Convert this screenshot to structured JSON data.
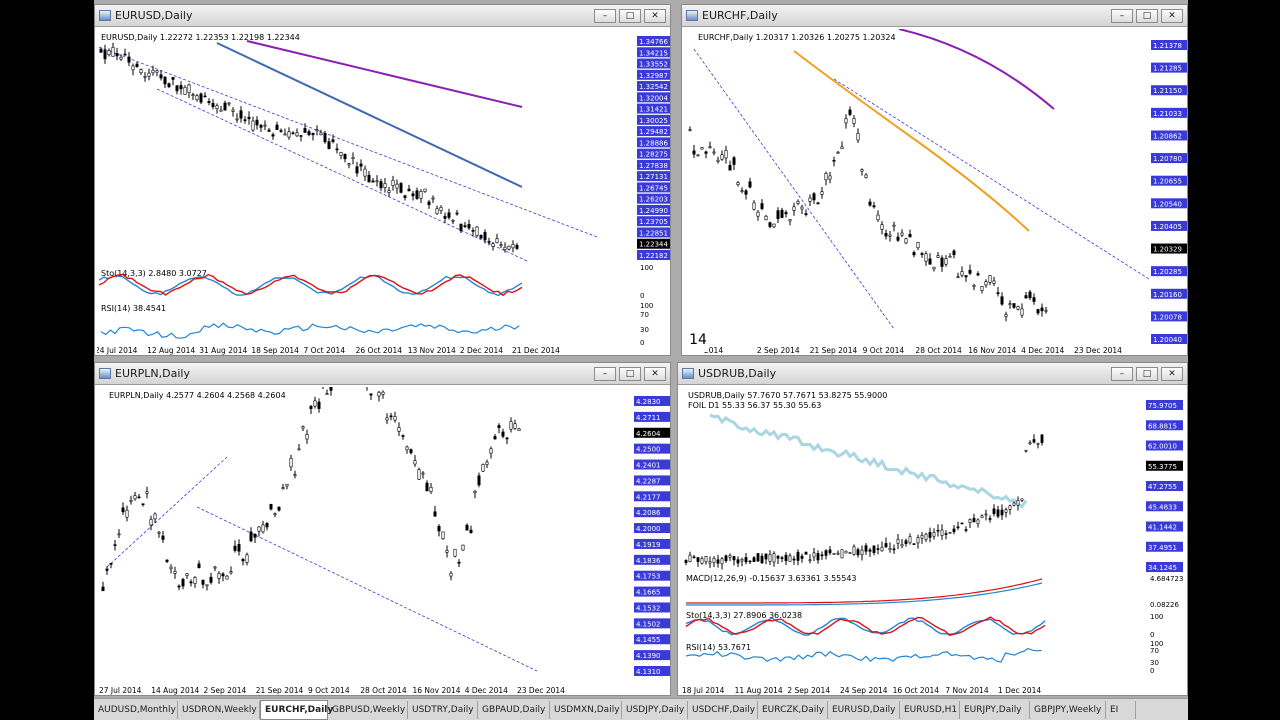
{
  "tabs": [
    {
      "label": "AUDUSD,Monthly",
      "w": 84
    },
    {
      "label": "USDRON,Weekly",
      "w": 82
    },
    {
      "label": "EURCHF,Daily",
      "w": 68,
      "active": true
    },
    {
      "label": "GBPUSD,Weekly",
      "w": 80
    },
    {
      "label": "USDTRY,Daily",
      "w": 70
    },
    {
      "label": "GBPAUD,Daily",
      "w": 72
    },
    {
      "label": "USDMXN,Daily",
      "w": 72
    },
    {
      "label": "USDJPY,Daily",
      "w": 66
    },
    {
      "label": "USDCHF,Daily",
      "w": 70
    },
    {
      "label": "EURCZK,Daily",
      "w": 70
    },
    {
      "label": "EURUSD,Daily",
      "w": 72
    },
    {
      "label": "EURUSD,H1",
      "w": 60
    },
    {
      "label": "EURJPY,Daily",
      "w": 70
    },
    {
      "label": "GBPJPY,Weekly",
      "w": 76
    },
    {
      "label": "EI",
      "w": 30
    }
  ],
  "windows": {
    "eurusd": {
      "title": "EURUSD,Daily",
      "header": "EURUSD,Daily  1.22272 1.22353 1.22198 1.22344",
      "prices": [
        "1.34766",
        "1.34215",
        "1.33552",
        "1.32987",
        "1.32542",
        "1.32004",
        "1.31421",
        "1.30025",
        "1.29482",
        "1.28886",
        "1.28275",
        "1.27838",
        "1.27131",
        "1.26745",
        "1.26203",
        "1.24990",
        "1.23705",
        "1.22851",
        "1.22344",
        "1.22182"
      ],
      "dates": [
        "24 Jul 2014",
        "12 Aug 2014",
        "31 Aug 2014",
        "18 Sep 2014",
        "7 Oct 2014",
        "26 Oct 2014",
        "13 Nov 2014",
        "2 Dec 2014",
        "21 Dec 2014"
      ],
      "sto_label": "Sto(14,3,3) 2.8480 3.0727",
      "sto_scale": [
        "100",
        "0"
      ],
      "rsi_label": "RSI(14) 38.4541",
      "rsi_scale": [
        "100",
        "70",
        "30",
        "0"
      ]
    },
    "eurchf": {
      "title": "EURCHF,Daily",
      "header": "EURCHF,Daily  1.20317 1.20326 1.20275 1.20324",
      "prices": [
        "1.21378",
        "1.21285",
        "1.21150",
        "1.21033",
        "1.20862",
        "1.20780",
        "1.20655",
        "1.20540",
        "1.20405",
        "1.20329",
        "1.20285",
        "1.20160",
        "1.20078",
        "1.20040"
      ],
      "dates": [
        "2014",
        "2 Sep 2014",
        "21 Sep 2014",
        "9 Oct 2014",
        "28 Oct 2014",
        "16 Nov 2014",
        "4 Dec 2014",
        "23 Dec 2014"
      ],
      "badge": "14"
    },
    "eurpln": {
      "title": "EURPLN,Daily",
      "header": "EURPLN,Daily  4.2577 4.2604 4.2568 4.2604",
      "prices": [
        "4.2830",
        "4.2711",
        "4.2604",
        "4.2500",
        "4.2401",
        "4.2287",
        "4.2177",
        "4.2086",
        "4.2000",
        "4.1919",
        "4.1836",
        "4.1753",
        "4.1665",
        "4.1532",
        "4.1502",
        "4.1455",
        "4.1390",
        "4.1310"
      ],
      "dates": [
        "27 Jul 2014",
        "14 Aug 2014",
        "2 Sep 2014",
        "21 Sep 2014",
        "9 Oct 2014",
        "28 Oct 2014",
        "16 Nov 2014",
        "4 Dec 2014",
        "23 Dec 2014"
      ]
    },
    "usdrub": {
      "title": "USDRUB,Daily",
      "header": "USDRUB,Daily  57.7670 57.7671 53.8275 55.9000",
      "foil": "FOIL D1 55.33 56.37 55.30 55.63",
      "prices": [
        "75.9705",
        "68.8815",
        "62.0010",
        "55.3775",
        "47.2755",
        "45.4833",
        "41.1442",
        "37.4951",
        "34.1245"
      ],
      "dates": [
        "18 Jul 2014",
        "11 Aug 2014",
        "2 Sep 2014",
        "24 Sep 2014",
        "16 Oct 2014",
        "7 Nov 2014",
        "1 Dec 2014"
      ],
      "macd_label": "MACD(12,26,9) -0.15637 3.63361 3.55543",
      "macd_scale": [
        "4.684723",
        "0.08226"
      ],
      "sto_label": "Sto(14,3,3) 27.8906 36.0238",
      "sto_scale": [
        "100",
        "0"
      ],
      "rsi_label": "RSI(14) 53.7671",
      "rsi_scale": [
        "100",
        "70",
        "30",
        "0"
      ]
    }
  },
  "colors": {
    "candle": "#000000",
    "grid": "#3a3ad8",
    "ma_purple": "#8b1fb4",
    "ma_blue": "#3f69b0",
    "ma_orange": "#f0a020",
    "sto_red": "#e01010",
    "sto_blue": "#1f86d8",
    "rsi": "#1f86d8",
    "zone": "#c7d6f4",
    "fib": "#5ec8c8"
  }
}
